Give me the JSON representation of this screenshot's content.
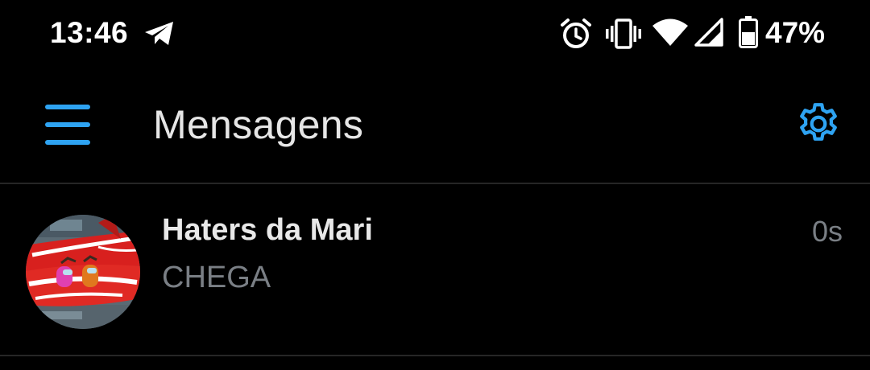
{
  "status_bar": {
    "time": "13:46",
    "battery_percent": "47%",
    "icons": [
      "telegram-icon",
      "alarm-icon",
      "vibrate-icon",
      "wifi-icon",
      "cell-signal-icon",
      "battery-icon"
    ]
  },
  "toolbar": {
    "title": "Mensagens",
    "menu_icon": "hamburger-menu-icon",
    "settings_icon": "gear-icon",
    "accent_color": "#2ea3f2"
  },
  "conversations": [
    {
      "name": "Haters da Mari",
      "preview": "CHEGA",
      "time": "0s"
    }
  ],
  "colors": {
    "background": "#000000",
    "primary_text": "#e8e8e8",
    "secondary_text": "#7a7f85",
    "divider": "#262626"
  }
}
